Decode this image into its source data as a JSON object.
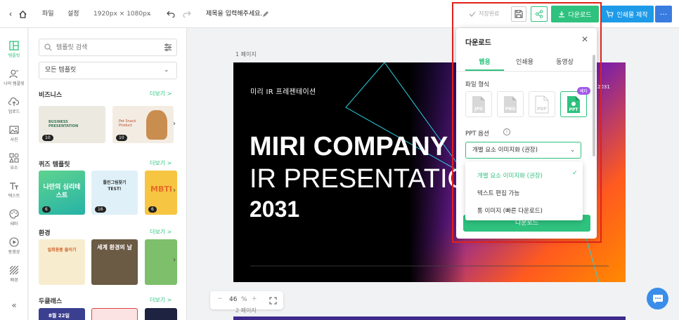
{
  "header": {
    "menu_file": "파일",
    "menu_settings": "설정",
    "size": "1920px × 1080px",
    "doc_title": "제목을 입력해주세요.",
    "save_status": "저장완료",
    "download_label": "다운로드",
    "print_label": "인쇄물 제작"
  },
  "leftnav": {
    "items": [
      {
        "label": "템플릿",
        "icon": "layout-icon"
      },
      {
        "label": "나의 템플릿",
        "icon": "user-template-icon"
      },
      {
        "label": "업로드",
        "icon": "cloud-upload-icon"
      },
      {
        "label": "사진",
        "icon": "photo-icon"
      },
      {
        "label": "요소",
        "icon": "shapes-icon"
      },
      {
        "label": "텍스트",
        "icon": "text-icon"
      },
      {
        "label": "테마",
        "icon": "palette-icon"
      },
      {
        "label": "동영상",
        "icon": "play-icon"
      },
      {
        "label": "배경",
        "icon": "pattern-icon"
      }
    ]
  },
  "panel": {
    "search_placeholder": "템플릿 검색",
    "filter_selected": "모든 템플릿",
    "more_label": "더보기 >",
    "categories": [
      {
        "title": "비즈니스",
        "counts": [
          "10",
          "10"
        ],
        "thumb_text": [
          "BUSINESS PRESENTATION",
          "Pet Snack Product"
        ]
      },
      {
        "title": "퀴즈 템플릿",
        "counts": [
          "6",
          "16",
          "6"
        ],
        "thumb_text": [
          "나만의 심리테스트",
          "틀린그림찾기 TEST!",
          "MBTI"
        ]
      },
      {
        "title": "환경",
        "counts": [],
        "thumb_text": [
          "일회용품 줄이기",
          "세계 환경의 날",
          ""
        ]
      },
      {
        "title": "두클래스",
        "counts": [],
        "thumb_text": [
          "8월 22일",
          "",
          ""
        ]
      }
    ]
  },
  "canvas": {
    "page_label": "1 페이지",
    "page2_label": "2 페이지",
    "zoom": "46",
    "zoom_unit": "%",
    "slide": {
      "subtitle": "미리 IR 프레젠테이션",
      "line1": "MIRI COMPANY",
      "line2": "IR PRESENTATION",
      "line3": "2031",
      "corner_year": "2031"
    }
  },
  "popup": {
    "title": "다운로드",
    "tabs": [
      "웹용",
      "인쇄용",
      "동영상"
    ],
    "file_format_label": "파일 형식",
    "formats": [
      "JPG",
      "PNG",
      "PDF",
      "PPT"
    ],
    "beta_label": "베타",
    "ppt_option_label": "PPT 옵션",
    "ppt_selected": "개별 요소 이미지화 (권장)",
    "options": [
      "개별 요소 이미지화 (권장)",
      "텍스트 편집 가능",
      "통 이미지 (빠른 다운로드)"
    ],
    "download_button": "다운로드"
  },
  "colors": {
    "accent": "#2ec27e",
    "print": "#1e9be8",
    "highlight": "#e0221b"
  }
}
